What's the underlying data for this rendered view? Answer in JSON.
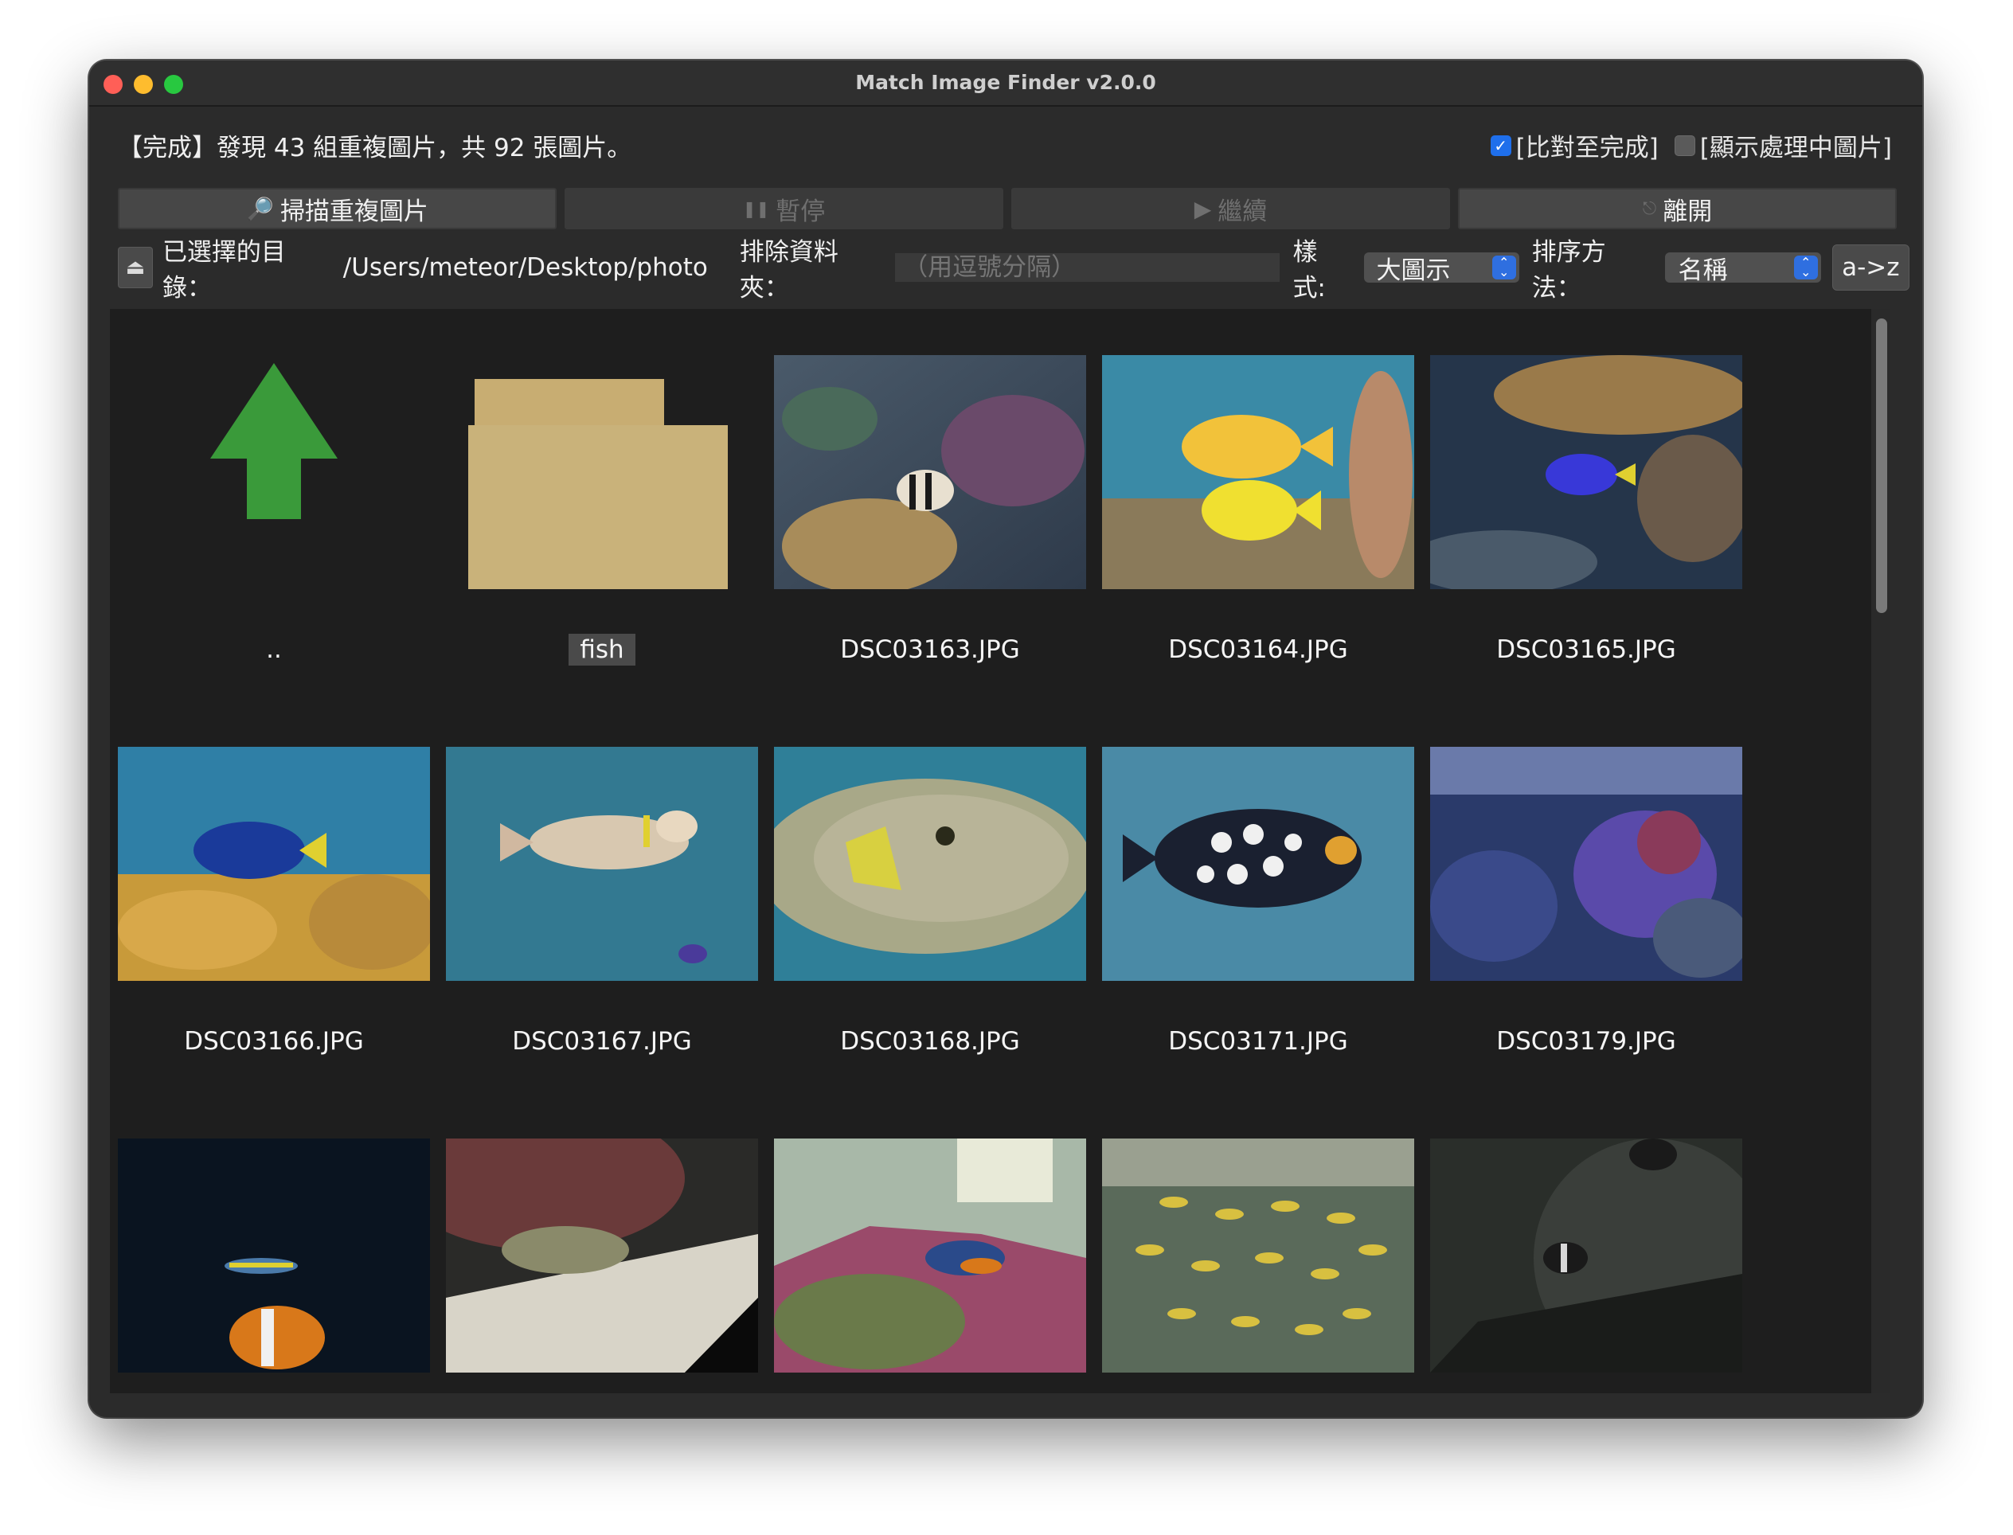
{
  "window": {
    "title": "Match Image Finder v2.0.0"
  },
  "status": {
    "text": "【完成】發現 43 組重複圖片，共 92 張圖片。"
  },
  "options": {
    "compare_label": "[比對至完成]",
    "compare_checked": true,
    "show_processing_label": "[顯示處理中圖片]",
    "show_processing_checked": false
  },
  "toolbar": {
    "scan_label": "掃描重複圖片",
    "pause_label": "暫停",
    "resume_label": "繼續",
    "quit_label": "離開"
  },
  "directory": {
    "selected_label": "已選擇的目錄：",
    "path": "/Users/meteor/Desktop/photo",
    "exclude_label": "排除資料夾：",
    "exclude_placeholder": "（用逗號分隔）",
    "style_label": "樣式:",
    "style_value": "大圖示",
    "sort_label": "排序方法：",
    "sort_value": "名稱",
    "sort_direction": "a->z"
  },
  "grid": {
    "items": [
      {
        "name": "..",
        "kind": "parent-folder"
      },
      {
        "name": "fish",
        "kind": "folder"
      },
      {
        "name": "DSC03163.JPG",
        "kind": "image"
      },
      {
        "name": "DSC03164.JPG",
        "kind": "image"
      },
      {
        "name": "DSC03165.JPG",
        "kind": "image"
      },
      {
        "name": "DSC03166.JPG",
        "kind": "image"
      },
      {
        "name": "DSC03167.JPG",
        "kind": "image"
      },
      {
        "name": "DSC03168.JPG",
        "kind": "image"
      },
      {
        "name": "DSC03171.JPG",
        "kind": "image"
      },
      {
        "name": "DSC03179.JPG",
        "kind": "image"
      },
      {
        "name": "",
        "kind": "image"
      },
      {
        "name": "",
        "kind": "image"
      },
      {
        "name": "",
        "kind": "image"
      },
      {
        "name": "",
        "kind": "image"
      },
      {
        "name": "",
        "kind": "image"
      }
    ]
  },
  "colors": {
    "accent": "#2f6fe0",
    "window_bg": "#2b2b2b",
    "grid_bg": "#1e1e1e",
    "folder": "#c9b27a",
    "arrow": "#3a9a3a"
  }
}
